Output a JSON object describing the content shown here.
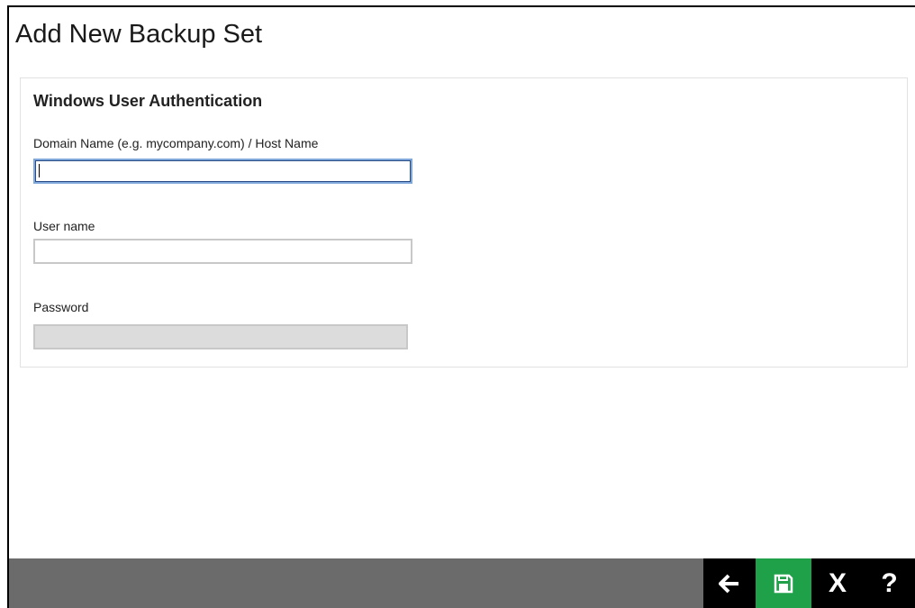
{
  "header": {
    "title": "Add New Backup Set"
  },
  "auth": {
    "section_title": "Windows User Authentication",
    "domain_label": "Domain Name (e.g. mycompany.com) / Host Name",
    "domain_value": "",
    "username_label": "User name",
    "username_value": "",
    "password_label": "Password",
    "password_value": ""
  },
  "toolbar": {
    "back_icon": "arrow-left-icon",
    "save_icon": "floppy-disk-icon",
    "cancel_label": "X",
    "help_label": "?",
    "colors": {
      "bar": "#6b6b6b",
      "save_bg": "#1fa14a",
      "button_bg": "#000000"
    }
  }
}
